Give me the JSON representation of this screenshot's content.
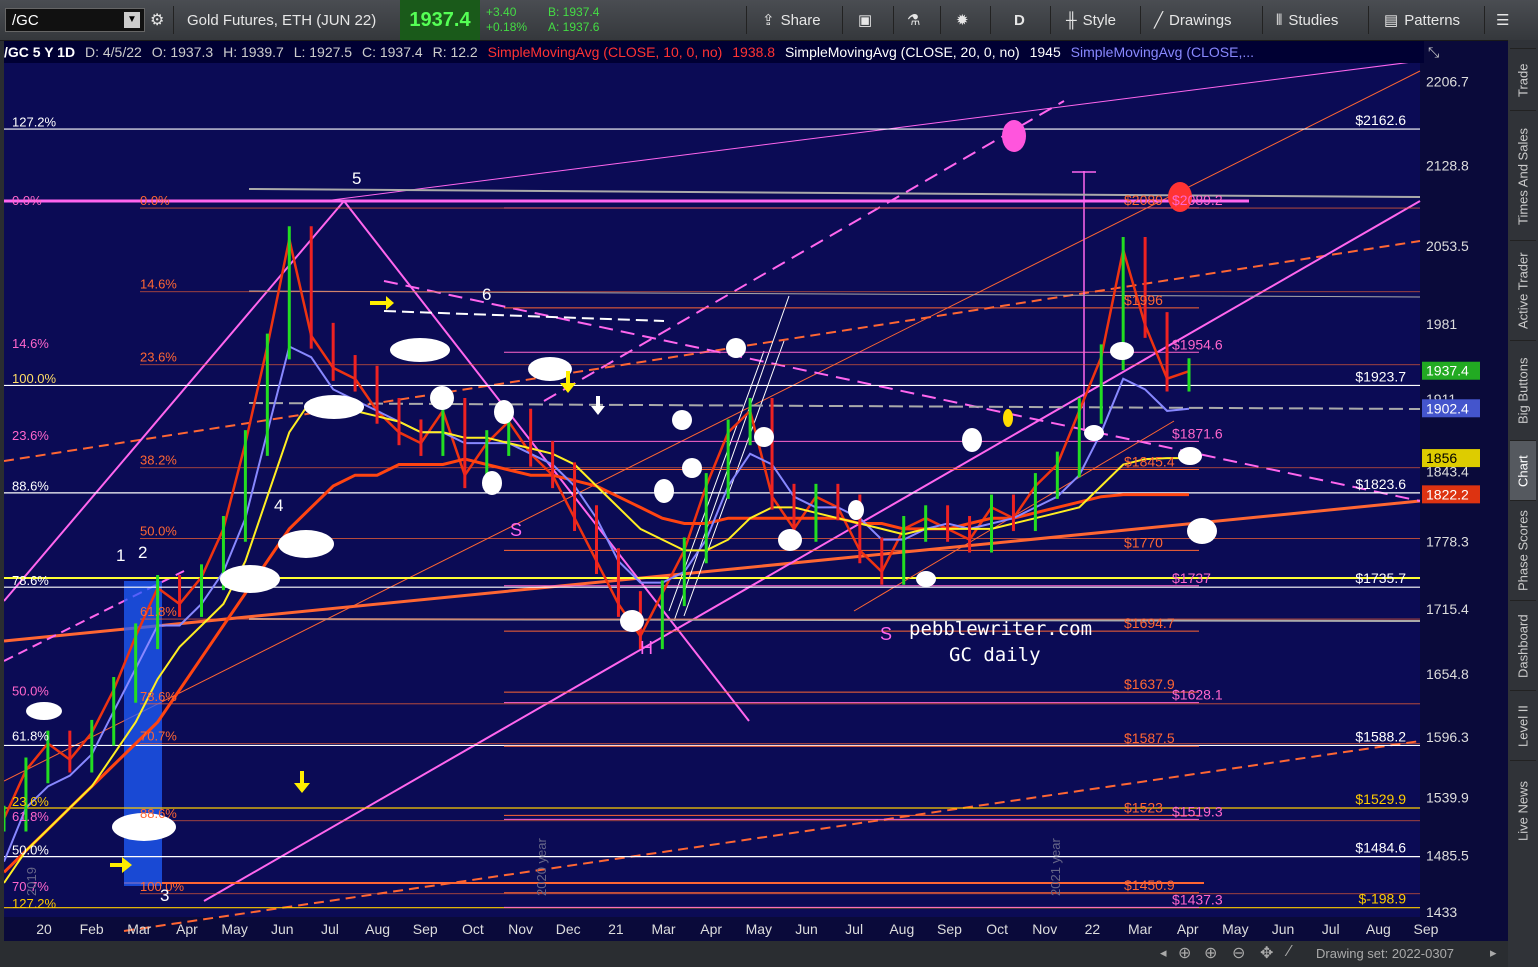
{
  "toolbar": {
    "symbol": "/GC",
    "description": "Gold Futures, ETH (JUN 22)",
    "last": "1937.4",
    "change": "+3.40",
    "change_pct": "+0.18%",
    "bid": "B: 1937.4",
    "ask": "A: 1937.6",
    "share": "Share",
    "period": "D",
    "style": "Style",
    "drawings": "Drawings",
    "studies": "Studies",
    "patterns": "Patterns"
  },
  "infobar": {
    "title": "/GC 5 Y 1D",
    "date": "D: 4/5/22",
    "open": "O: 1937.3",
    "high": "H: 1939.7",
    "low": "L: 1927.5",
    "close": "C: 1937.4",
    "range": "R: 12.2",
    "sma10": "SimpleMovingAvg (CLOSE, 10, 0, no)",
    "sma10_val": "1938.8",
    "sma20": "SimpleMovingAvg (CLOSE, 20, 0, no)",
    "sma20_val": "1945",
    "sma_more": "SimpleMovingAvg (CLOSE,..."
  },
  "right_tabs": [
    "Trade",
    "Times And Sales",
    "Active Trader",
    "Big Buttons",
    "Chart",
    "Phase Scores",
    "Dashboard",
    "Level II",
    "Live News"
  ],
  "bottom": {
    "drawing_set": "Drawing set: 2022-0307"
  },
  "chart_data": {
    "type": "line",
    "ylim": [
      1433,
      2240
    ],
    "y_ticks": [
      "2206.7",
      "2128.8",
      "2053.5",
      "1981",
      "1911",
      "1843.4",
      "1778.3",
      "1715.4",
      "1654.8",
      "1596.3",
      "1539.9",
      "1485.5",
      "1433"
    ],
    "x_ticks": [
      "20",
      "Feb",
      "Mar",
      "Apr",
      "May",
      "Jun",
      "Jul",
      "Aug",
      "Sep",
      "Oct",
      "Nov",
      "Dec",
      "21",
      "Mar",
      "Apr",
      "May",
      "Jun",
      "Jul",
      "Aug",
      "Sep",
      "Oct",
      "Nov",
      "22",
      "Mar",
      "Apr",
      "May",
      "Jun",
      "Jul",
      "Aug",
      "Sep"
    ],
    "price_badges": [
      {
        "label": "1937.4",
        "value": 1937.4,
        "color": "#22aa22"
      },
      {
        "label": "1902.4",
        "value": 1902.4,
        "color": "#4455cc"
      },
      {
        "label": "1856",
        "value": 1856,
        "color": "#ddcc00"
      },
      {
        "label": "1822.2",
        "value": 1822.2,
        "color": "#dd3311"
      }
    ],
    "right_levels": [
      {
        "label": "$2162.6",
        "value": 2162.6,
        "color": "#ffffff"
      },
      {
        "label": "$1923.7",
        "value": 1923.7,
        "color": "#ffffff"
      },
      {
        "label": "$1823.6",
        "value": 1823.6,
        "color": "#ffffff"
      },
      {
        "label": "$1735.7",
        "value": 1735.7,
        "color": "#ffffff"
      },
      {
        "label": "$1588.2",
        "value": 1588.2,
        "color": "#ffffff"
      },
      {
        "label": "$1529.9",
        "value": 1529.9,
        "color": "#ffcc00"
      },
      {
        "label": "$1484.6",
        "value": 1484.6,
        "color": "#ffffff"
      },
      {
        "label": "$-198.9",
        "value": 1437,
        "color": "#ffcc00"
      }
    ],
    "mid_levels": [
      {
        "label": "$2089",
        "value": 2089,
        "color": "#ff6633"
      },
      {
        "label": "$2089.2",
        "value": 2089,
        "color": "#ff66cc"
      },
      {
        "label": "$1996",
        "value": 1996,
        "color": "#ff6633"
      },
      {
        "label": "$1954.6",
        "value": 1954.6,
        "color": "#ff66cc"
      },
      {
        "label": "$1871.6",
        "value": 1871.6,
        "color": "#ff66cc"
      },
      {
        "label": "$1845.4",
        "value": 1845.4,
        "color": "#ff6633"
      },
      {
        "label": "$1770",
        "value": 1770,
        "color": "#ff6633"
      },
      {
        "label": "$1737",
        "value": 1737,
        "color": "#ff66cc"
      },
      {
        "label": "$1694.7",
        "value": 1694.7,
        "color": "#ff6633"
      },
      {
        "label": "$1637.9",
        "value": 1637.9,
        "color": "#ff6633"
      },
      {
        "label": "$1628.1",
        "value": 1628.1,
        "color": "#ff66cc"
      },
      {
        "label": "$1587.5",
        "value": 1587.5,
        "color": "#ff6633"
      },
      {
        "label": "$1523",
        "value": 1523,
        "color": "#ff6633"
      },
      {
        "label": "$1519.3",
        "value": 1519.3,
        "color": "#ff66cc"
      },
      {
        "label": "$1450.9",
        "value": 1450.9,
        "color": "#ff6633"
      },
      {
        "label": "$1437.3",
        "value": 1437.3,
        "color": "#ff66cc"
      }
    ],
    "fib_left": [
      {
        "label": "127.2%",
        "value": 2162,
        "color": "#ffffff"
      },
      {
        "label": "0.0%",
        "value": 2089,
        "color": "#ff66cc"
      },
      {
        "label": "14.6%",
        "value": 1956,
        "color": "#ff66cc"
      },
      {
        "label": "100.0%",
        "value": 1923,
        "color": "#ffdd66"
      },
      {
        "label": "23.6%",
        "value": 1870,
        "color": "#ff66cc"
      },
      {
        "label": "88.6%",
        "value": 1823,
        "color": "#ffffff"
      },
      {
        "label": "78.6%",
        "value": 1735,
        "color": "#ffffff"
      },
      {
        "label": "50.0%",
        "value": 1632,
        "color": "#ff66cc"
      },
      {
        "label": "61.8%",
        "value": 1590,
        "color": "#ffffff"
      },
      {
        "label": "23.6%",
        "value": 1529,
        "color": "#ffcc00"
      },
      {
        "label": "61.8%",
        "value": 1515,
        "color": "#ff66cc"
      },
      {
        "label": "50.0%",
        "value": 1484,
        "color": "#ffffff"
      },
      {
        "label": "70.7%",
        "value": 1450,
        "color": "#ff66cc"
      },
      {
        "label": "127.2%",
        "value": 1434,
        "color": "#ffcc00"
      }
    ],
    "fib_mid": [
      {
        "label": "0.0%",
        "value": 2089
      },
      {
        "label": "14.6%",
        "value": 2011
      },
      {
        "label": "23.6%",
        "value": 1943
      },
      {
        "label": "38.2%",
        "value": 1847
      },
      {
        "label": "50.0%",
        "value": 1781
      },
      {
        "label": "61.8%",
        "value": 1706
      },
      {
        "label": "78.6%",
        "value": 1627
      },
      {
        "label": "70.7%",
        "value": 1590
      },
      {
        "label": "88.6%",
        "value": 1518
      },
      {
        "label": "100.0%",
        "value": 1450
      }
    ],
    "wave_labels": [
      "1",
      "2",
      "3",
      "4",
      "5",
      "6"
    ],
    "pattern_labels": [
      "S",
      "H",
      "S"
    ],
    "year_labels": [
      "2020 year",
      "2021 year",
      "2019"
    ],
    "watermark": [
      "pebblewriter.com",
      "GC daily"
    ],
    "series": [
      {
        "name": "price",
        "values": [
          1520,
          1565,
          1590,
          1575,
          1600,
          1640,
          1690,
          1735,
          1720,
          1745,
          1790,
          1870,
          1960,
          2060,
          1970,
          1940,
          1930,
          1900,
          1880,
          1870,
          1900,
          1840,
          1870,
          1890,
          1860,
          1840,
          1800,
          1760,
          1720,
          1690,
          1730,
          1770,
          1830,
          1880,
          1900,
          1820,
          1790,
          1820,
          1810,
          1770,
          1750,
          1790,
          1800,
          1790,
          1780,
          1810,
          1800,
          1830,
          1850,
          1900,
          1950,
          2050,
          1980,
          1930,
          1937
        ]
      },
      {
        "name": "sma200",
        "values": [
          1470,
          1490,
          1510,
          1530,
          1550,
          1570,
          1590,
          1610,
          1640,
          1670,
          1700,
          1730,
          1760,
          1790,
          1810,
          1830,
          1840,
          1840,
          1850,
          1850,
          1850,
          1855,
          1850,
          1845,
          1840,
          1840,
          1835,
          1830,
          1820,
          1810,
          1800,
          1795,
          1795,
          1800,
          1800,
          1800,
          1800,
          1800,
          1800,
          1795,
          1795,
          1790,
          1790,
          1790,
          1795,
          1800,
          1800,
          1805,
          1810,
          1815,
          1820,
          1822,
          1822,
          1822,
          1822
        ]
      },
      {
        "name": "sma50",
        "values": [
          1480,
          1530,
          1550,
          1560,
          1580,
          1620,
          1660,
          1700,
          1700,
          1720,
          1750,
          1800,
          1880,
          1960,
          1950,
          1920,
          1910,
          1900,
          1890,
          1880,
          1880,
          1870,
          1870,
          1870,
          1860,
          1850,
          1830,
          1800,
          1760,
          1740,
          1740,
          1750,
          1780,
          1830,
          1860,
          1850,
          1820,
          1810,
          1810,
          1800,
          1780,
          1780,
          1790,
          1795,
          1790,
          1795,
          1800,
          1810,
          1820,
          1840,
          1880,
          1930,
          1920,
          1900,
          1902
        ]
      },
      {
        "name": "sma100",
        "values": [
          1460,
          1490,
          1510,
          1530,
          1550,
          1580,
          1610,
          1650,
          1680,
          1700,
          1720,
          1760,
          1820,
          1880,
          1910,
          1910,
          1900,
          1895,
          1890,
          1880,
          1880,
          1875,
          1875,
          1870,
          1865,
          1860,
          1850,
          1830,
          1810,
          1790,
          1780,
          1770,
          1770,
          1780,
          1800,
          1810,
          1810,
          1805,
          1800,
          1795,
          1790,
          1785,
          1790,
          1790,
          1790,
          1790,
          1795,
          1800,
          1805,
          1810,
          1830,
          1850,
          1855,
          1856,
          1856
        ]
      }
    ]
  }
}
